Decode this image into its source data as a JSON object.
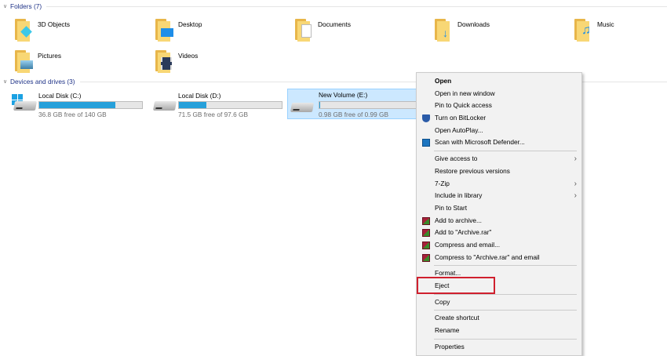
{
  "folders_header": "Folders (7)",
  "folders": [
    {
      "name": "3D Objects",
      "icon": "3d-objects-folder-icon"
    },
    {
      "name": "Desktop",
      "icon": "desktop-folder-icon"
    },
    {
      "name": "Documents",
      "icon": "documents-folder-icon"
    },
    {
      "name": "Downloads",
      "icon": "downloads-folder-icon"
    },
    {
      "name": "Music",
      "icon": "music-folder-icon"
    },
    {
      "name": "Pictures",
      "icon": "pictures-folder-icon"
    },
    {
      "name": "Videos",
      "icon": "videos-folder-icon"
    }
  ],
  "drives_header": "Devices and drives (3)",
  "drives": [
    {
      "name": "Local Disk (C:)",
      "free": "36.8 GB free of 140 GB",
      "used_fraction": 0.74
    },
    {
      "name": "Local Disk (D:)",
      "free": "71.5 GB free of 97.6 GB",
      "used_fraction": 0.27
    },
    {
      "name": "New Volume (E:)",
      "free": "0.98 GB free of 0.99 GB",
      "used_fraction": 0.01
    }
  ],
  "menu": [
    "Open",
    "Open in new window",
    "Pin to Quick access",
    "Turn on BitLocker",
    "Open AutoPlay...",
    "Scan with Microsoft Defender...",
    "Give access to",
    "Restore previous versions",
    "7-Zip",
    "Include in library",
    "Pin to Start",
    "Add to archive...",
    "Add to \"Archive.rar\"",
    "Compress and email...",
    "Compress to \"Archive.rar\" and email",
    "Format...",
    "Eject",
    "Copy",
    "Create shortcut",
    "Rename",
    "Properties"
  ],
  "colors": {
    "accent": "#26a0da",
    "highlight": "#d0202e",
    "selected": "#cce8ff"
  }
}
